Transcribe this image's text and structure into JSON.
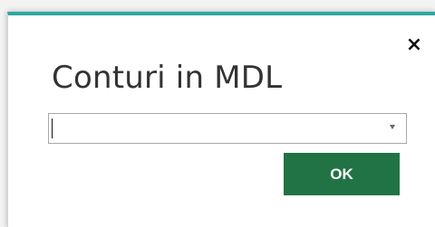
{
  "dialog": {
    "title": "Conturi in MDL",
    "close_icon": "×",
    "dropdown": {
      "value": "",
      "chevron_icon": "chevron-down-icon"
    },
    "ok_label": "OK"
  },
  "colors": {
    "accent": "#2fa7a1",
    "button": "#217346",
    "text": "#333333"
  }
}
